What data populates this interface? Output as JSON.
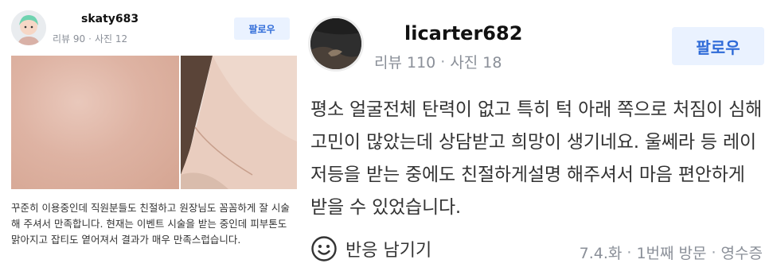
{
  "left_review": {
    "username": "skaty683",
    "reviews_label": "리뷰 90",
    "photos_label": "사진 12",
    "follow_label": "팔로우",
    "review_text": "꾸준히 이용중인데 직원분들도 친절하고 원장님도 꼼꼼하게 잘 시술해 주셔서 만족합니다. 현재는 이벤트 시술을 받는 중인데 피부톤도 맑아지고 잡티도 옅어져서 결과가 매우 만족스럽습니다."
  },
  "right_review": {
    "username": "licarter682",
    "reviews_label": "리뷰 110",
    "photos_label": "사진 18",
    "follow_label": "팔로우",
    "review_text": "평소 얼굴전체 탄력이 없고 특히 턱 아래 쪽으로 처짐이 심해 고민이 많았는데 상담받고 희망이 생기네요. 울쎄라 등 레이저등을 받는 중에도 친절하게설명 해주셔서 마음 편안하게 받을 수 있었습니다.",
    "reaction_label": "반응 남기기",
    "visit_date": "7.4.화",
    "visit_count": "1번째 방문",
    "receipt_label": "영수증"
  },
  "colors": {
    "follow_bg": "#eaf2ff",
    "follow_text": "#2f6bd8",
    "meta_text": "#8a8f98"
  },
  "icons": {
    "left_avatar": "avatar-icon",
    "reaction": "smiley-icon"
  }
}
